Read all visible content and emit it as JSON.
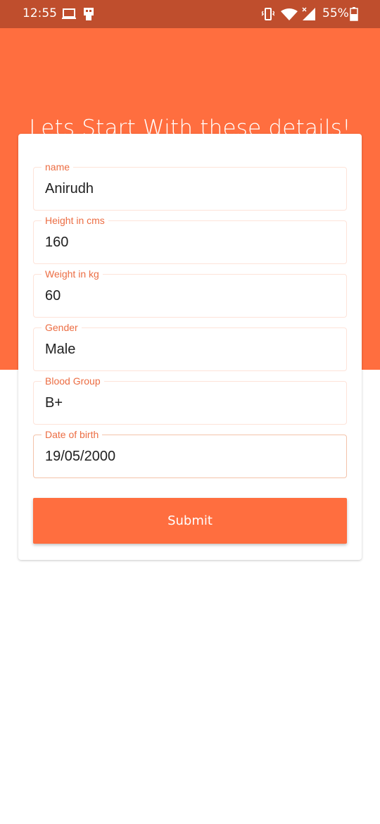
{
  "status_bar": {
    "time": "12:55",
    "battery": "55%",
    "icons": [
      "laptop-icon",
      "usb-icon",
      "vibrate-icon",
      "wifi-icon",
      "signal-icon",
      "battery-icon"
    ]
  },
  "header": {
    "title": "Lets Start With these details!"
  },
  "form": {
    "fields": [
      {
        "label": "name",
        "value": "Anirudh"
      },
      {
        "label": "Height in cms",
        "value": "160"
      },
      {
        "label": "Weight in kg",
        "value": "60"
      },
      {
        "label": "Gender",
        "value": "Male"
      },
      {
        "label": "Blood Group",
        "value": "B+"
      },
      {
        "label": "Date of birth",
        "value": "19/05/2000"
      }
    ],
    "submit_label": "Submit"
  },
  "colors": {
    "accent": "#ff6e3f",
    "status_bar": "#bf4e2d",
    "label": "#ec6d43"
  }
}
